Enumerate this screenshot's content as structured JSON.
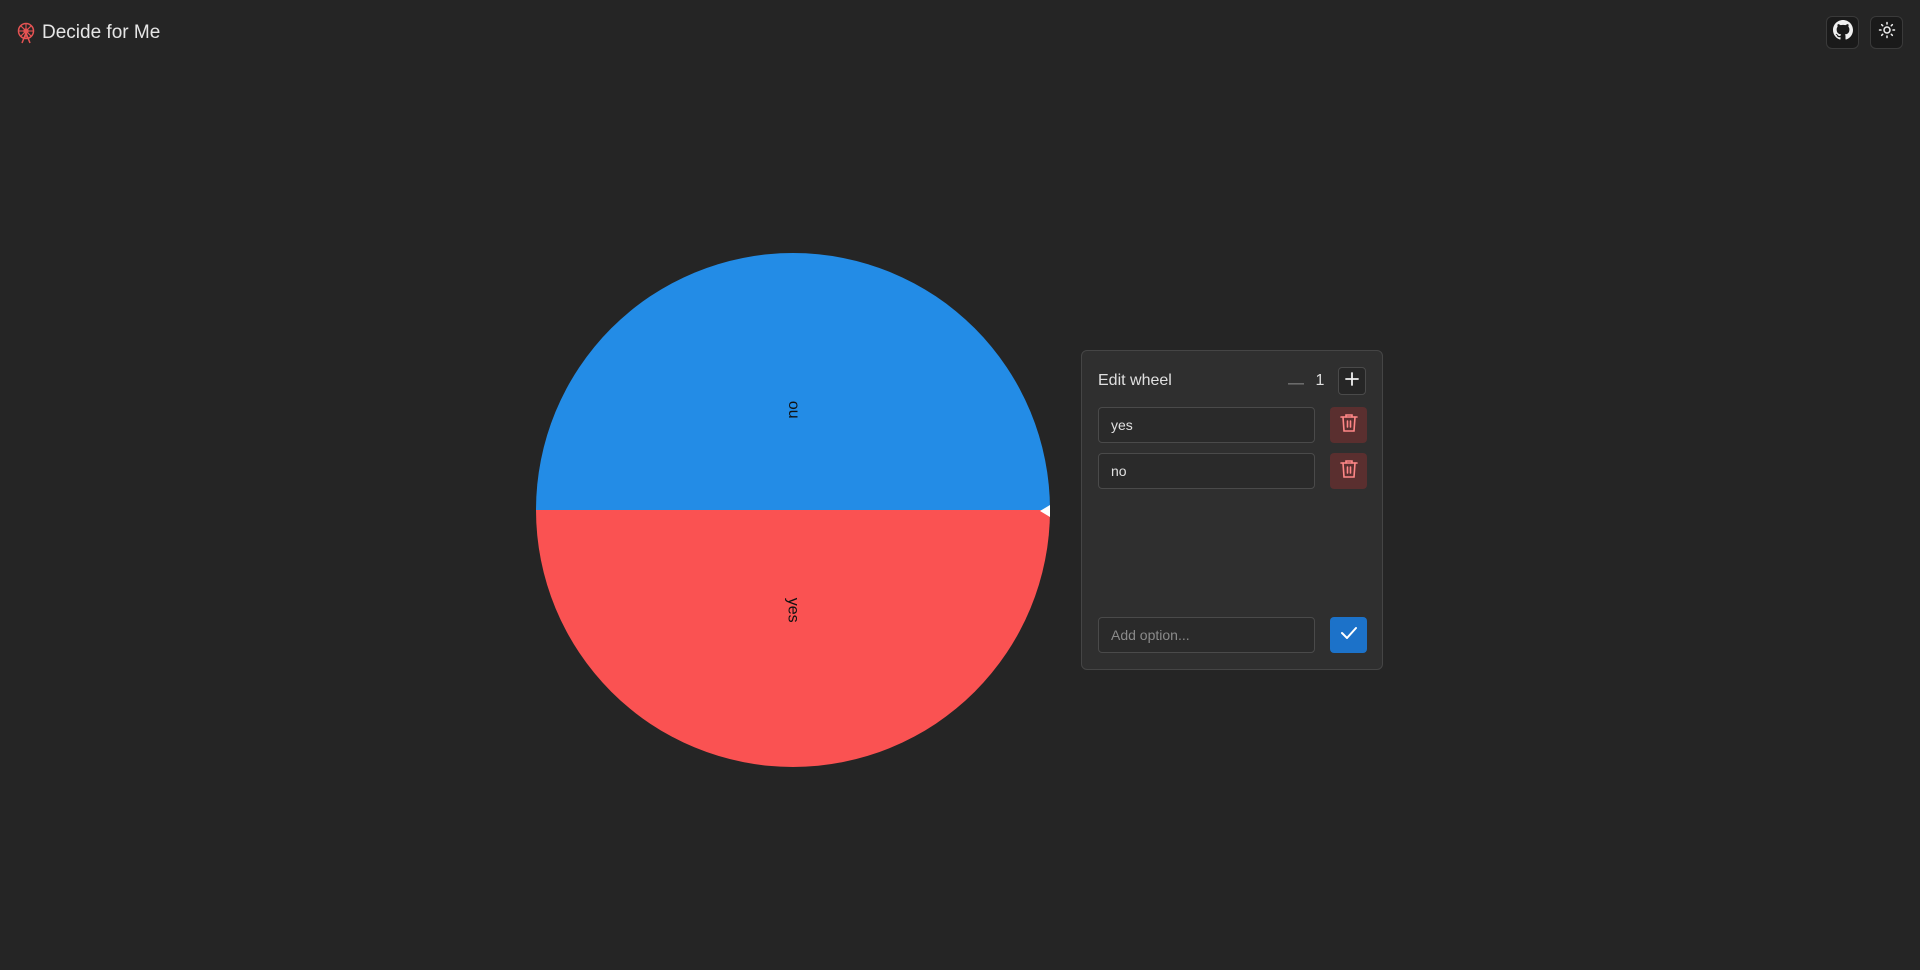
{
  "header": {
    "title": "Decide for Me",
    "logo_icon": "ferris-wheel-icon",
    "github_icon": "github-icon",
    "theme_icon": "sun-icon"
  },
  "wheel": {
    "segments": [
      {
        "label": "no",
        "color": "#238ce6"
      },
      {
        "label": "yes",
        "color": "#fa5252"
      }
    ]
  },
  "editor": {
    "title": "Edit wheel",
    "stepper_value": "1",
    "options": [
      {
        "value": "yes"
      },
      {
        "value": "no"
      }
    ],
    "add_placeholder": "Add option...",
    "accent_color": "#1c72c9",
    "delete_color": "#5a2f2f"
  }
}
